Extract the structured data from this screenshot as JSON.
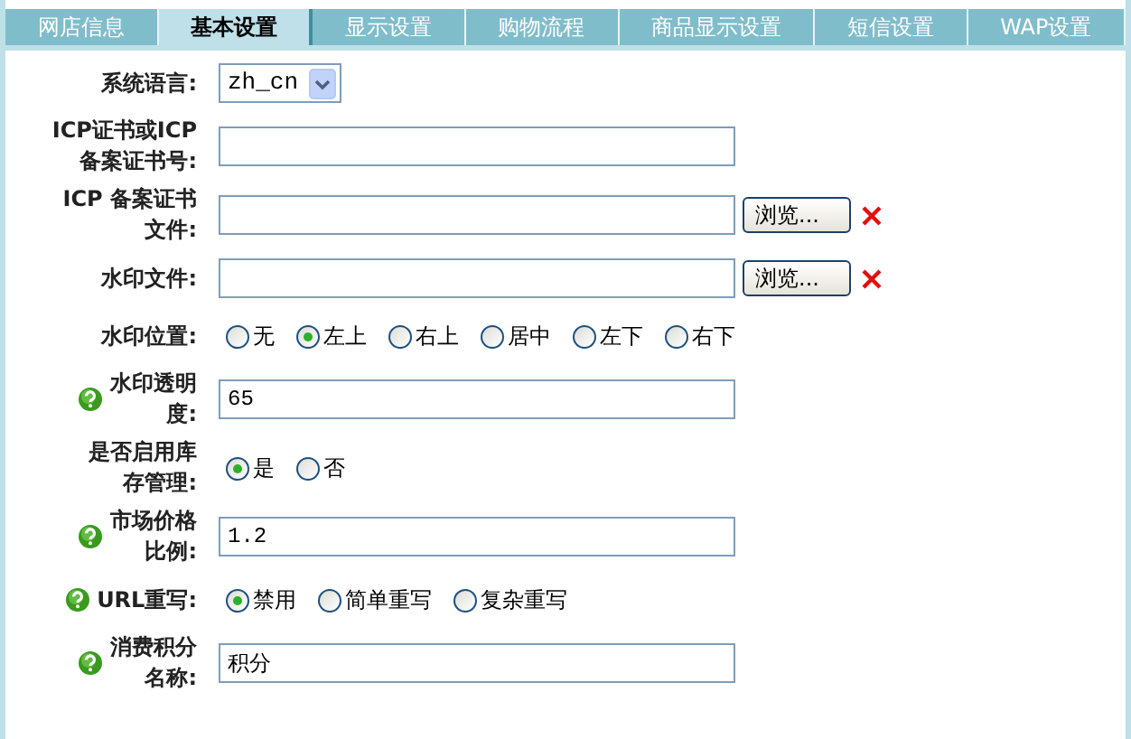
{
  "tabs": [
    {
      "label": "网店信息",
      "selected": false
    },
    {
      "label": "基本设置",
      "selected": true
    },
    {
      "label": "显示设置",
      "selected": false
    },
    {
      "label": "购物流程",
      "selected": false
    },
    {
      "label": "商品显示设置",
      "selected": false
    },
    {
      "label": "短信设置",
      "selected": false
    },
    {
      "label": "WAP设置",
      "selected": false
    }
  ],
  "fields": [
    {
      "label": [
        "系统语言:"
      ],
      "help": false,
      "kind": "select",
      "value": "zh_cn"
    },
    {
      "label": [
        "ICP证书或ICP",
        "备案证书号:"
      ],
      "help": false,
      "kind": "text"
    },
    {
      "label": [
        "ICP 备案证书",
        "文件:"
      ],
      "help": false,
      "kind": "file",
      "button": "浏览..."
    },
    {
      "label": [
        "水印文件:"
      ],
      "help": false,
      "kind": "file",
      "button": "浏览..."
    },
    {
      "label": [
        "水印位置:"
      ],
      "help": false,
      "kind": "radio",
      "options": [
        {
          "label": "无",
          "selected": false
        },
        {
          "label": "左上",
          "selected": true
        },
        {
          "label": "右上",
          "selected": false
        },
        {
          "label": "居中",
          "selected": false
        },
        {
          "label": "左下",
          "selected": false
        },
        {
          "label": "右下",
          "selected": false
        }
      ]
    },
    {
      "label": [
        "水印透明",
        "度:"
      ],
      "help": true,
      "kind": "text",
      "value": "65"
    },
    {
      "label": [
        "是否启用库",
        "存管理:"
      ],
      "help": false,
      "kind": "radio",
      "options": [
        {
          "label": "是",
          "selected": true
        },
        {
          "label": "否",
          "selected": false
        }
      ]
    },
    {
      "label": [
        "市场价格",
        "比例:"
      ],
      "help": true,
      "kind": "text",
      "value": "1.2"
    },
    {
      "label": [
        "URL重写:"
      ],
      "help": true,
      "kind": "radio",
      "options": [
        {
          "label": "禁用",
          "selected": true
        },
        {
          "label": "简单重写",
          "selected": false
        },
        {
          "label": "复杂重写",
          "selected": false
        }
      ]
    },
    {
      "label": [
        "消费积分",
        "名称:"
      ],
      "help": true,
      "kind": "text",
      "value": "积分"
    }
  ]
}
